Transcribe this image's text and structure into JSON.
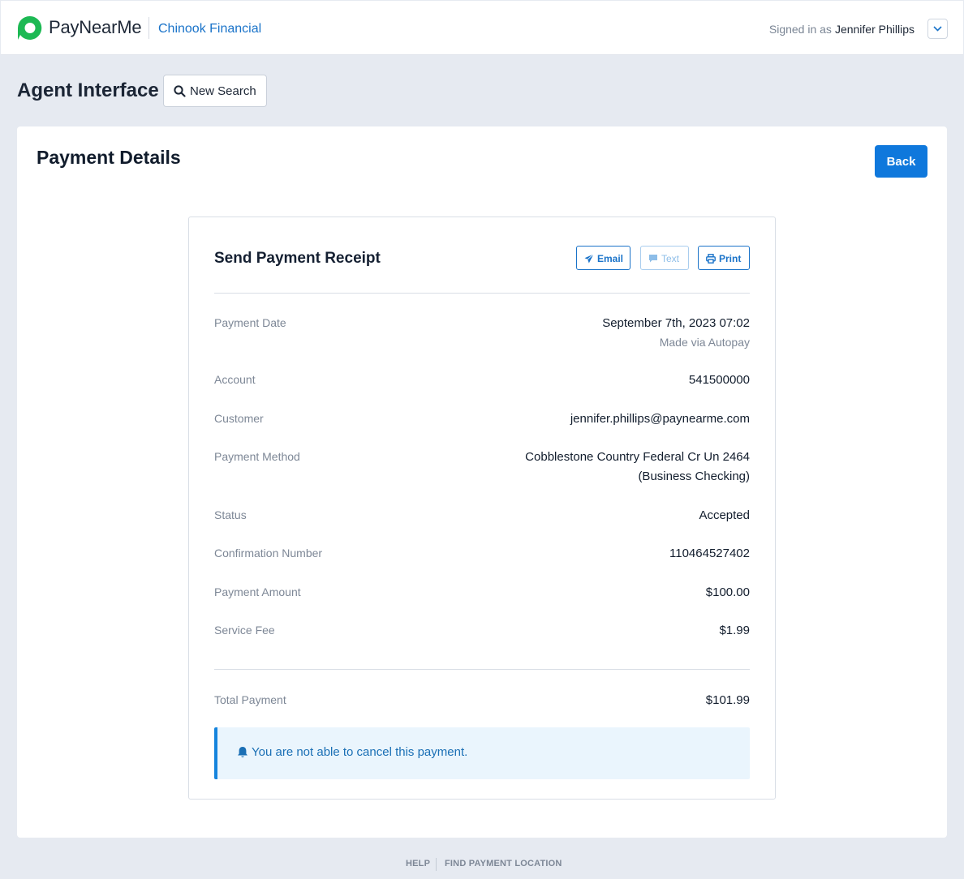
{
  "header": {
    "brand": "PayNearMe",
    "client": "Chinook Financial",
    "signed_in_label": "Signed in as",
    "user_name": "Jennifer Phillips",
    "brand_color": "#1db954"
  },
  "toolbar": {
    "title": "Agent Interface",
    "new_search_label": "New Search"
  },
  "page": {
    "title": "Payment Details",
    "back_label": "Back"
  },
  "receipt": {
    "title": "Send Payment Receipt",
    "actions": {
      "email": "Email",
      "text": "Text",
      "print": "Print"
    },
    "rows": [
      {
        "label": "Payment Date",
        "value": "September 7th, 2023 07:02",
        "sub": "Made via Autopay"
      },
      {
        "label": "Account",
        "value": "541500000"
      },
      {
        "label": "Customer",
        "value": "jennifer.phillips@paynearme.com"
      },
      {
        "label": "Payment Method",
        "value": "Cobblestone Country Federal Cr Un 2464",
        "value2": "(Business Checking)"
      },
      {
        "label": "Status",
        "value": "Accepted"
      },
      {
        "label": "Confirmation Number",
        "value": "110464527402"
      },
      {
        "label": "Payment Amount",
        "value": "$100.00"
      },
      {
        "label": "Service Fee",
        "value": "$1.99"
      }
    ],
    "total": {
      "label": "Total Payment",
      "value": "$101.99"
    },
    "notice": "You are not able to cancel this payment."
  },
  "footer": {
    "help": "HELP",
    "find_location": "FIND PAYMENT LOCATION"
  }
}
